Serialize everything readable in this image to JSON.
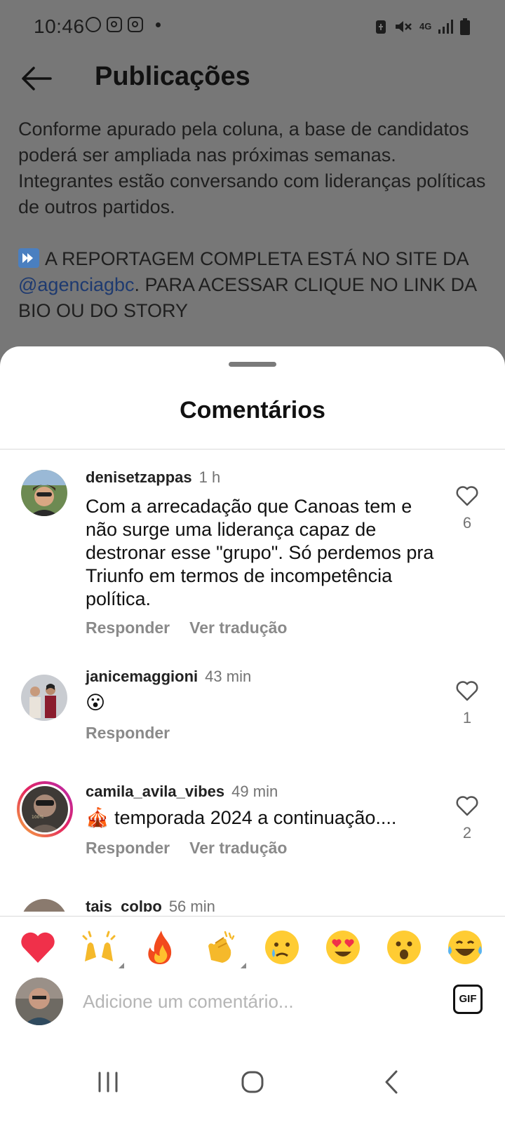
{
  "status_bar": {
    "time": "10:46",
    "network": "4G"
  },
  "header": {
    "title": "Publicações"
  },
  "post": {
    "paragraph1": "Conforme apurado pela coluna, a base de candidatos poderá ser ampliada nas próximas semanas. Integrantes estão conversando com lideranças políticas de outros partidos.",
    "paragraph2_prefix": "A REPORTAGEM COMPLETA ESTÁ NO SITE DA",
    "mention": "@agenciagbc",
    "paragraph2_suffix": ". PARA ACESSAR CLIQUE NO LINK DA BIO OU DO STORY"
  },
  "sheet": {
    "title": "Comentários"
  },
  "comments": [
    {
      "username": "denisetzappas",
      "time": "1 h",
      "text": "Com a arrecadação que Canoas tem e não surge uma liderança capaz de destronar esse \"grupo\". Só perdemos pra Triunfo em termos de incompetência política.",
      "reply_label": "Responder",
      "translate_label": "Ver tradução",
      "likes": "6"
    },
    {
      "username": "janicemaggioni",
      "time": "43 min",
      "text": "😮",
      "reply_label": "Responder",
      "likes": "1"
    },
    {
      "username": "camila_avila_vibes",
      "time": "49 min",
      "text": "🎪 temporada 2024 a continuação....",
      "reply_label": "Responder",
      "translate_label": "Ver tradução",
      "likes": "2"
    },
    {
      "username": "tais_colpo",
      "time": "56 min"
    }
  ],
  "quick_reactions": [
    "❤️",
    "🙌",
    "🔥",
    "👏",
    "😢",
    "😍",
    "😮",
    "😂"
  ],
  "composer": {
    "placeholder": "Adicione um comentário...",
    "gif_label": "GIF"
  },
  "colors": {
    "sheet_bg": "#ffffff",
    "dim_bg": "#777777",
    "mention": "#1e3a70",
    "muted": "#737373"
  }
}
